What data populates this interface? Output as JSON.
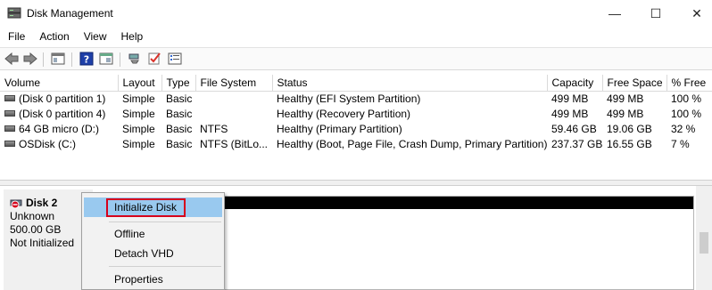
{
  "window": {
    "title": "Disk Management",
    "controls": {
      "minimize": "—",
      "maximize": "☐",
      "close": "✕"
    }
  },
  "menubar": {
    "items": [
      "File",
      "Action",
      "View",
      "Help"
    ]
  },
  "toolbar": {
    "icons": [
      "back-icon",
      "forward-icon",
      "show-hide-console-tree-icon",
      "help-icon",
      "properties-icon",
      "connect-icon",
      "check-icon",
      "list-icon"
    ]
  },
  "volume_table": {
    "columns": [
      "Volume",
      "Layout",
      "Type",
      "File System",
      "Status",
      "Capacity",
      "Free Space",
      "% Free"
    ],
    "rows": [
      [
        "(Disk 0 partition 1)",
        "Simple",
        "Basic",
        "",
        "Healthy (EFI System Partition)",
        "499 MB",
        "499 MB",
        "100 %"
      ],
      [
        "(Disk 0 partition 4)",
        "Simple",
        "Basic",
        "",
        "Healthy (Recovery Partition)",
        "499 MB",
        "499 MB",
        "100 %"
      ],
      [
        "64 GB micro (D:)",
        "Simple",
        "Basic",
        "NTFS",
        "Healthy (Primary Partition)",
        "59.46 GB",
        "19.06 GB",
        "32 %"
      ],
      [
        "OSDisk (C:)",
        "Simple",
        "Basic",
        "NTFS (BitLo...",
        "Healthy (Boot, Page File, Crash Dump, Primary Partition)",
        "237.37 GB",
        "16.55 GB",
        "7 %"
      ]
    ]
  },
  "disk": {
    "name": "Disk 2",
    "type": "Unknown",
    "size": "500.00 GB",
    "state": "Not Initialized"
  },
  "context_menu": {
    "items": [
      "Initialize Disk",
      "Offline",
      "Detach VHD",
      "Properties"
    ],
    "highlighted": "Initialize Disk",
    "highlight_color": "#99c9ef",
    "annotation_color": "#d6001c"
  }
}
